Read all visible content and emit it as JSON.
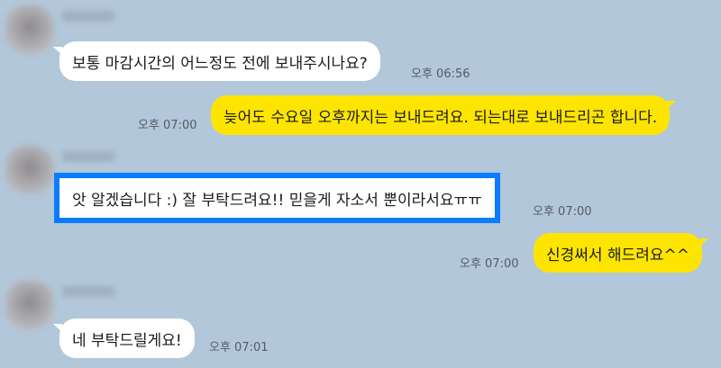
{
  "messages": [
    {
      "sender": "other",
      "text": "보통 마감시간의 어느정도 전에 보내주시나요?",
      "time": "오후 06:56"
    },
    {
      "sender": "me",
      "text": "늦어도 수요일 오후까지는 보내드려요. 되는대로 보내드리곤 합니다.",
      "time": "오후 07:00"
    },
    {
      "sender": "other",
      "text": "앗 알겠습니다 :) 잘 부탁드려요!! 믿을게 자소서 뿐이라서요ㅠㅠ",
      "time": "오후 07:00"
    },
    {
      "sender": "me",
      "text": "신경써서 해드려요^^",
      "time": "오후 07:00"
    },
    {
      "sender": "other",
      "text": "네 부탁드릴게요!",
      "time": "오후 07:01"
    }
  ],
  "colors": {
    "background": "#b2c7d9",
    "incoming_bubble": "#ffffff",
    "outgoing_bubble": "#fee500",
    "highlight_border": "#0a7cff"
  }
}
